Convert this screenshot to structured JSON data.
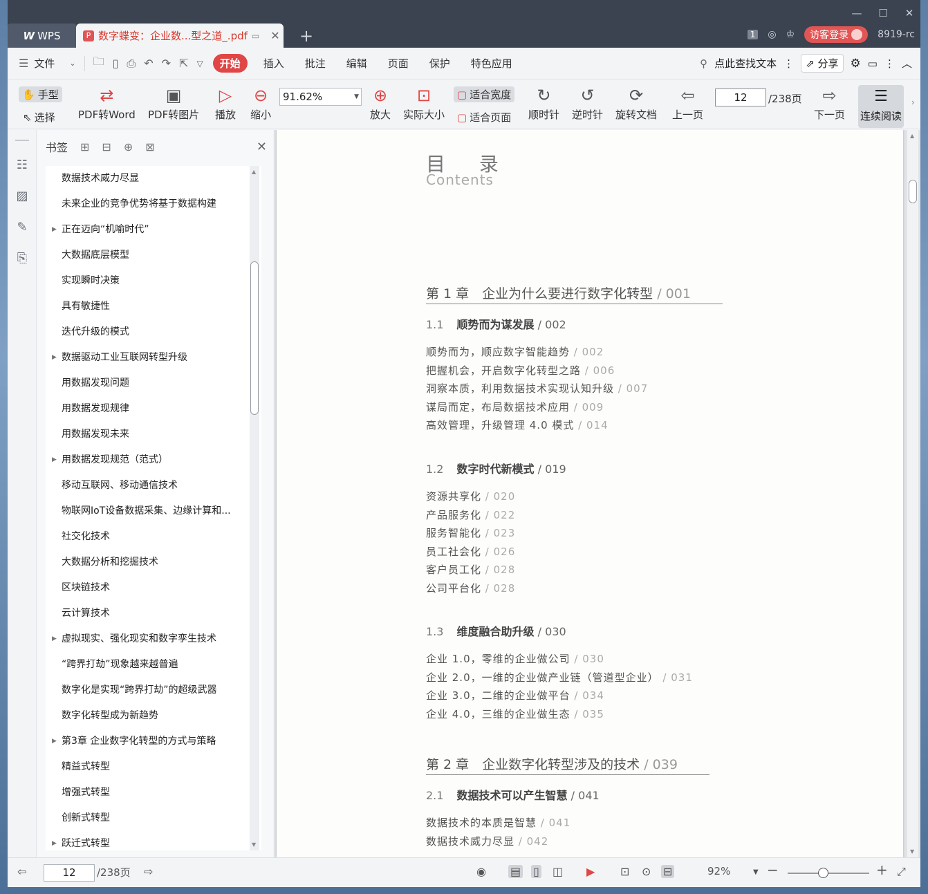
{
  "titlebar": {
    "app_tab": "WPS",
    "doc_tab": "数字蝶变：企业数...型之道_.pdf",
    "counter": "1",
    "login": "访客登录",
    "version": "8919-rc"
  },
  "menu": {
    "file": "文件",
    "tabs": [
      "开始",
      "插入",
      "批注",
      "编辑",
      "页面",
      "保护",
      "特色应用"
    ],
    "search": "点此查找文本",
    "share": "分享"
  },
  "toolbar": {
    "hand": "手型",
    "select": "选择",
    "pdf_to_word": "PDF转Word",
    "pdf_to_image": "PDF转图片",
    "play": "播放",
    "zoom_out": "缩小",
    "zoom_value": "91.62%",
    "zoom_in": "放大",
    "actual_size": "实际大小",
    "fit_width": "适合宽度",
    "fit_page": "适合页面",
    "rotate_cw": "顺时针",
    "rotate_ccw": "逆时针",
    "rotate_doc": "旋转文档",
    "prev_page": "上一页",
    "page_value": "12",
    "page_total": "/238页",
    "next_page": "下一页",
    "continuous": "连续阅读"
  },
  "bookmarks": {
    "title": "书签",
    "items": [
      {
        "label": "数据技术威力尽显",
        "expandable": false
      },
      {
        "label": "未来企业的竞争优势将基于数据构建",
        "expandable": false
      },
      {
        "label": "正在迈向“机喻时代”",
        "expandable": true
      },
      {
        "label": "大数据底层模型",
        "expandable": false
      },
      {
        "label": "实现瞬时决策",
        "expandable": false
      },
      {
        "label": "具有敏捷性",
        "expandable": false
      },
      {
        "label": "迭代升级的模式",
        "expandable": false
      },
      {
        "label": "数据驱动工业互联网转型升级",
        "expandable": true
      },
      {
        "label": "用数据发现问题",
        "expandable": false
      },
      {
        "label": "用数据发现规律",
        "expandable": false
      },
      {
        "label": "用数据发现未来",
        "expandable": false
      },
      {
        "label": "用数据发现规范（范式）",
        "expandable": true
      },
      {
        "label": "移动互联网、移动通信技术",
        "expandable": false
      },
      {
        "label": "物联网IoT设备数据采集、边缘计算和...",
        "expandable": false
      },
      {
        "label": "社交化技术",
        "expandable": false
      },
      {
        "label": "大数据分析和挖掘技术",
        "expandable": false
      },
      {
        "label": "区块链技术",
        "expandable": false
      },
      {
        "label": "云计算技术",
        "expandable": false
      },
      {
        "label": "虚拟现实、强化现实和数字孪生技术",
        "expandable": true
      },
      {
        "label": "“跨界打劫”现象越来越普遍",
        "expandable": false
      },
      {
        "label": "数字化是实现“跨界打劫”的超级武器",
        "expandable": false
      },
      {
        "label": "数字化转型成为新趋势",
        "expandable": false
      },
      {
        "label": "第3章 企业数字化转型的方式与策略",
        "expandable": true
      },
      {
        "label": "精益式转型",
        "expandable": false
      },
      {
        "label": "增强式转型",
        "expandable": false
      },
      {
        "label": "创新式转型",
        "expandable": false
      },
      {
        "label": "跃迁式转型",
        "expandable": true
      }
    ]
  },
  "document": {
    "title": "目 录",
    "subtitle": "Contents",
    "ch1": {
      "name": "第 1 章　企业为什么要进行数字化转型",
      "page": "/ 001"
    },
    "s11": {
      "num": "1.1",
      "name": "顺势而为谋发展",
      "page": "/ 002"
    },
    "s11_items": [
      {
        "text": "顺势而为，顺应数字智能趋势",
        "page": "/ 002"
      },
      {
        "text": "把握机会，开启数字化转型之路",
        "page": "/ 006"
      },
      {
        "text": "洞察本质，利用数据技术实现认知升级",
        "page": "/ 007"
      },
      {
        "text": "谋局而定，布局数据技术应用",
        "page": "/ 009"
      },
      {
        "text": "高效管理，升级管理 4.0 模式",
        "page": "/ 014"
      }
    ],
    "s12": {
      "num": "1.2",
      "name": "数字时代新模式",
      "page": "/ 019"
    },
    "s12_items": [
      {
        "text": "资源共享化",
        "page": "/ 020"
      },
      {
        "text": "产品服务化",
        "page": "/ 022"
      },
      {
        "text": "服务智能化",
        "page": "/ 023"
      },
      {
        "text": "员工社会化",
        "page": "/ 026"
      },
      {
        "text": "客户员工化",
        "page": "/ 028"
      },
      {
        "text": "公司平台化",
        "page": "/ 028"
      }
    ],
    "s13": {
      "num": "1.3",
      "name": "维度融合助升级",
      "page": "/ 030"
    },
    "s13_items": [
      {
        "text": "企业 1.0，零维的企业做公司",
        "page": "/ 030"
      },
      {
        "text": "企业 2.0，一维的企业做产业链（管道型企业）",
        "page": "/ 031"
      },
      {
        "text": "企业 3.0，二维的企业做平台",
        "page": "/ 034"
      },
      {
        "text": "企业 4.0，三维的企业做生态",
        "page": "/ 035"
      }
    ],
    "ch2": {
      "name": "第 2 章　企业数字化转型涉及的技术",
      "page": "/ 039"
    },
    "s21": {
      "num": "2.1",
      "name": "数据技术可以产生智慧",
      "page": "/ 041"
    },
    "s21_items": [
      {
        "text": "数据技术的本质是智慧",
        "page": "/ 041"
      },
      {
        "text": "数据技术威力尽显",
        "page": "/ 042"
      }
    ]
  },
  "statusbar": {
    "page_value": "12",
    "page_total": "/238页",
    "zoom": "92%"
  },
  "colors": {
    "accent": "#e04646",
    "titlebar": "#3b4250",
    "active_tab_text": "#d9362b"
  }
}
